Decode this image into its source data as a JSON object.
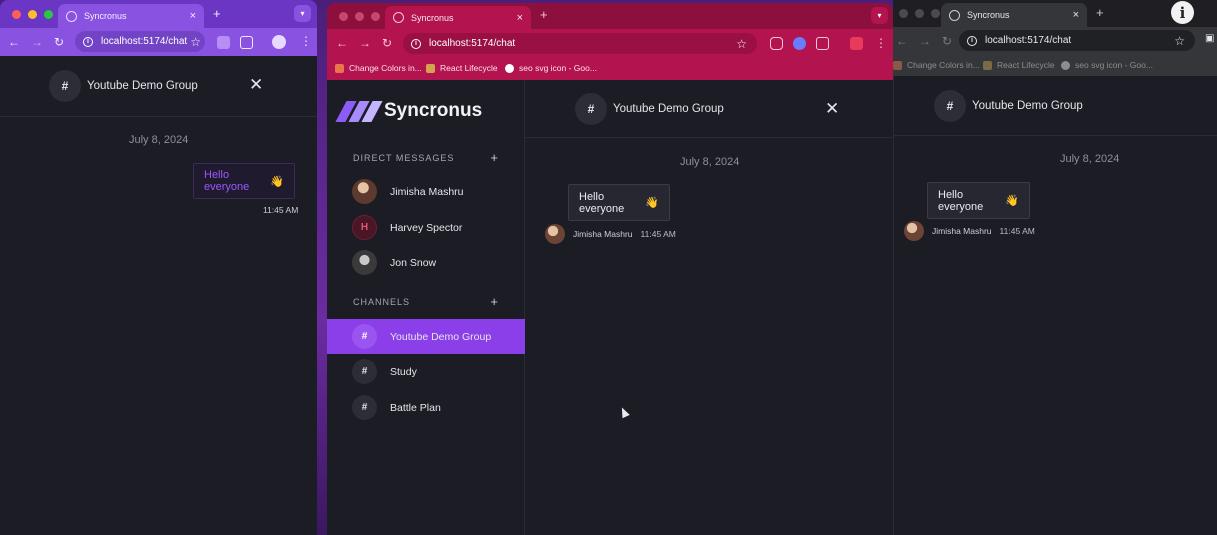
{
  "app_name": "Syncronus",
  "url": "localhost:5174/chat",
  "tab_title": "Syncronus",
  "bookmarks": [
    "Change Colors in...",
    "React Lifecycle",
    "seo svg icon - Goo..."
  ],
  "chat": {
    "group_name": "Youtube Demo Group",
    "date": "July 8, 2024",
    "message_text": "Hello everyone",
    "message_emoji": "👋",
    "sender": "Jimisha Mashru",
    "time": "11:45 AM"
  },
  "sidebar": {
    "direct_messages_label": "DIRECT MESSAGES",
    "channels_label": "CHANNELS",
    "contacts": [
      {
        "name": "Jimisha Mashru"
      },
      {
        "name": "Harvey Spector",
        "initial": "H"
      },
      {
        "name": "Jon Snow"
      }
    ],
    "channels": [
      {
        "name": "Youtube Demo Group",
        "active": true
      },
      {
        "name": "Study",
        "active": false
      },
      {
        "name": "Battle Plan",
        "active": false
      }
    ]
  },
  "colors": {
    "accent": "#8b3fe8",
    "left_chrome": "#7b3fd0",
    "middle_chrome": "#b3134f",
    "page_bg": "#1b1c24"
  },
  "icons": [
    "close-icon",
    "plus-icon",
    "hash-icon",
    "star-icon",
    "info-icon"
  ]
}
